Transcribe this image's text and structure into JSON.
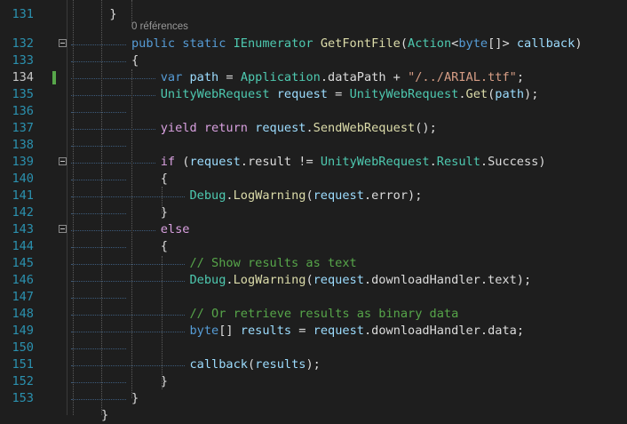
{
  "editor": {
    "codelens": "0 références",
    "lines": [
      {
        "n": "131",
        "tokens": [
          {
            "t": "}",
            "c": ""
          }
        ],
        "indent": 3
      },
      {
        "n": "132",
        "fold": true,
        "tokens": [
          {
            "t": "public",
            "c": "kw"
          },
          {
            "t": " ",
            "c": ""
          },
          {
            "t": "static",
            "c": "kw"
          },
          {
            "t": " ",
            "c": ""
          },
          {
            "t": "IEnumerator",
            "c": "ty"
          },
          {
            "t": " ",
            "c": ""
          },
          {
            "t": "GetFontFile",
            "c": "fn"
          },
          {
            "t": "(",
            "c": ""
          },
          {
            "t": "Action",
            "c": "ty"
          },
          {
            "t": "<",
            "c": ""
          },
          {
            "t": "byte",
            "c": "kw"
          },
          {
            "t": "[]> ",
            "c": ""
          },
          {
            "t": "callback",
            "c": "var"
          },
          {
            "t": ")",
            "c": ""
          }
        ]
      },
      {
        "n": "133",
        "tokens": [
          {
            "t": "{",
            "c": ""
          }
        ]
      },
      {
        "n": "134",
        "mark": true,
        "tokens": [
          {
            "t": "    ",
            "c": ""
          },
          {
            "t": "var",
            "c": "kw"
          },
          {
            "t": " ",
            "c": ""
          },
          {
            "t": "path",
            "c": "var"
          },
          {
            "t": " = ",
            "c": ""
          },
          {
            "t": "Application",
            "c": "ty"
          },
          {
            "t": ".dataPath + ",
            "c": ""
          },
          {
            "t": "\"/../ARIAL.ttf\"",
            "c": "str"
          },
          {
            "t": ";",
            "c": ""
          }
        ]
      },
      {
        "n": "135",
        "tokens": [
          {
            "t": "    ",
            "c": ""
          },
          {
            "t": "UnityWebRequest",
            "c": "ty"
          },
          {
            "t": " ",
            "c": ""
          },
          {
            "t": "request",
            "c": "var"
          },
          {
            "t": " = ",
            "c": ""
          },
          {
            "t": "UnityWebRequest",
            "c": "ty"
          },
          {
            "t": ".",
            "c": ""
          },
          {
            "t": "Get",
            "c": "fn"
          },
          {
            "t": "(",
            "c": ""
          },
          {
            "t": "path",
            "c": "var"
          },
          {
            "t": ");",
            "c": ""
          }
        ]
      },
      {
        "n": "136",
        "tokens": []
      },
      {
        "n": "137",
        "tokens": [
          {
            "t": "    ",
            "c": ""
          },
          {
            "t": "yield",
            "c": "ctl"
          },
          {
            "t": " ",
            "c": ""
          },
          {
            "t": "return",
            "c": "ctl"
          },
          {
            "t": " ",
            "c": ""
          },
          {
            "t": "request",
            "c": "var"
          },
          {
            "t": ".",
            "c": ""
          },
          {
            "t": "SendWebRequest",
            "c": "fn"
          },
          {
            "t": "();",
            "c": ""
          }
        ]
      },
      {
        "n": "138",
        "tokens": []
      },
      {
        "n": "139",
        "fold": true,
        "tokens": [
          {
            "t": "    ",
            "c": ""
          },
          {
            "t": "if",
            "c": "ctl"
          },
          {
            "t": " (",
            "c": ""
          },
          {
            "t": "request",
            "c": "var"
          },
          {
            "t": ".result != ",
            "c": ""
          },
          {
            "t": "UnityWebRequest",
            "c": "ty"
          },
          {
            "t": ".",
            "c": ""
          },
          {
            "t": "Result",
            "c": "ty"
          },
          {
            "t": ".Success)",
            "c": ""
          }
        ]
      },
      {
        "n": "140",
        "tokens": [
          {
            "t": "    {",
            "c": ""
          }
        ]
      },
      {
        "n": "141",
        "tokens": [
          {
            "t": "        ",
            "c": ""
          },
          {
            "t": "Debug",
            "c": "ty"
          },
          {
            "t": ".",
            "c": ""
          },
          {
            "t": "LogWarning",
            "c": "fn"
          },
          {
            "t": "(",
            "c": ""
          },
          {
            "t": "request",
            "c": "var"
          },
          {
            "t": ".error);",
            "c": ""
          }
        ]
      },
      {
        "n": "142",
        "tokens": [
          {
            "t": "    }",
            "c": ""
          }
        ]
      },
      {
        "n": "143",
        "fold": true,
        "tokens": [
          {
            "t": "    ",
            "c": ""
          },
          {
            "t": "else",
            "c": "ctl"
          }
        ]
      },
      {
        "n": "144",
        "tokens": [
          {
            "t": "    {",
            "c": ""
          }
        ]
      },
      {
        "n": "145",
        "tokens": [
          {
            "t": "        ",
            "c": ""
          },
          {
            "t": "// Show results as text",
            "c": "cm"
          }
        ]
      },
      {
        "n": "146",
        "tokens": [
          {
            "t": "        ",
            "c": ""
          },
          {
            "t": "Debug",
            "c": "ty"
          },
          {
            "t": ".",
            "c": ""
          },
          {
            "t": "LogWarning",
            "c": "fn"
          },
          {
            "t": "(",
            "c": ""
          },
          {
            "t": "request",
            "c": "var"
          },
          {
            "t": ".downloadHandler.text);",
            "c": ""
          }
        ]
      },
      {
        "n": "147",
        "tokens": []
      },
      {
        "n": "148",
        "tokens": [
          {
            "t": "        ",
            "c": ""
          },
          {
            "t": "// Or retrieve results as binary data",
            "c": "cm"
          }
        ]
      },
      {
        "n": "149",
        "tokens": [
          {
            "t": "        ",
            "c": ""
          },
          {
            "t": "byte",
            "c": "kw"
          },
          {
            "t": "[] ",
            "c": ""
          },
          {
            "t": "results",
            "c": "var"
          },
          {
            "t": " = ",
            "c": ""
          },
          {
            "t": "request",
            "c": "var"
          },
          {
            "t": ".downloadHandler.data;",
            "c": ""
          }
        ]
      },
      {
        "n": "150",
        "tokens": []
      },
      {
        "n": "151",
        "tokens": [
          {
            "t": "        ",
            "c": ""
          },
          {
            "t": "callback",
            "c": "var"
          },
          {
            "t": "(",
            "c": ""
          },
          {
            "t": "results",
            "c": "var"
          },
          {
            "t": ");",
            "c": ""
          }
        ]
      },
      {
        "n": "152",
        "tokens": [
          {
            "t": "    }",
            "c": ""
          }
        ]
      },
      {
        "n": "153",
        "tokens": [
          {
            "t": "}",
            "c": ""
          }
        ]
      }
    ],
    "trailing_brace": "}",
    "colors": {
      "background": "#1e1e1e",
      "line_number": "#2b91af",
      "keyword": "#569cd6",
      "control": "#d8a0df",
      "type": "#4ec9b0",
      "method": "#dcdcaa",
      "variable": "#9cdcfe",
      "string": "#d69d85",
      "comment": "#57a64a",
      "change_marker": "#57a64a"
    }
  }
}
